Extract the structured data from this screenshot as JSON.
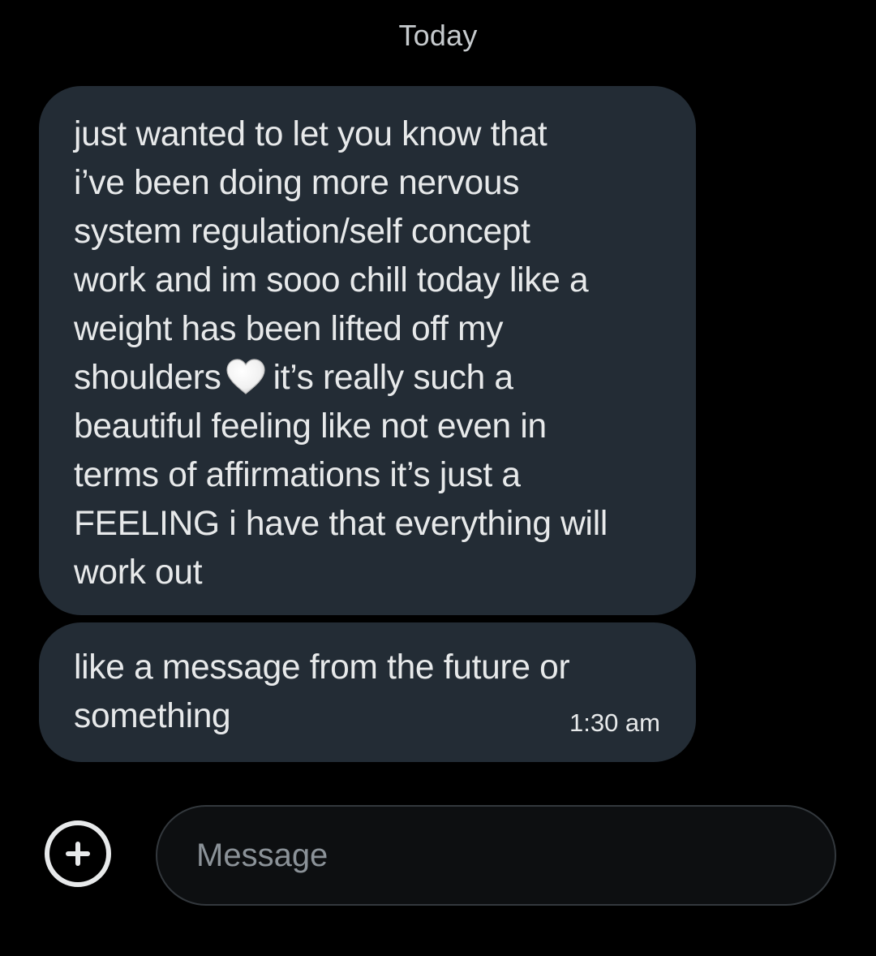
{
  "conversation": {
    "date_label": "Today",
    "messages": [
      {
        "lines": [
          "just wanted to let you know that",
          "i’ve been doing more nervous",
          "system regulation/self concept",
          "work and im sooo chill today like a",
          "weight has been lifted off my",
          "shoulders",
          "it’s really such a",
          "beautiful feeling like not even in",
          "terms of affirmations it’s just a",
          "FEELING i have that everything will",
          "work out"
        ],
        "emoji": "white-heart-icon"
      },
      {
        "lines": [
          "like a message from the future or",
          "something"
        ],
        "time": "1:30 am"
      }
    ]
  },
  "composer": {
    "add_icon": "plus-circle-icon",
    "placeholder": "Message",
    "value": ""
  },
  "colors": {
    "background": "#000000",
    "bubble": "#232c35",
    "text": "#e7e9ea",
    "placeholder": "#8b9298"
  }
}
